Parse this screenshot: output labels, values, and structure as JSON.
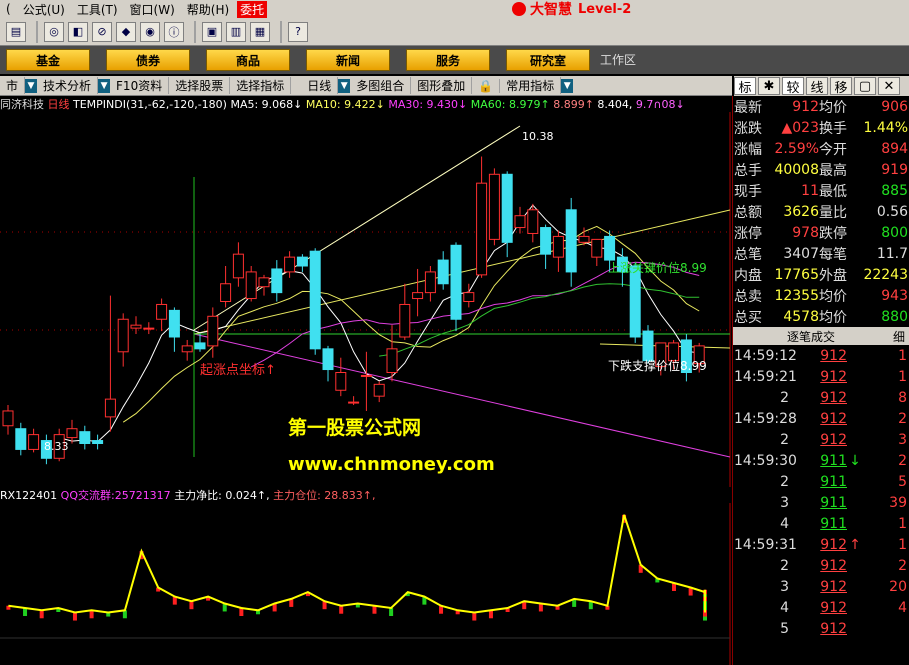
{
  "menu": {
    "items": [
      "公式(U)",
      "工具(T)",
      "窗口(W)",
      "帮助(H)"
    ],
    "lead": "(",
    "wt": "委托"
  },
  "brand": {
    "title": "大智慧",
    "level": "Level-2"
  },
  "nav": {
    "buttons": [
      "基金",
      "债券",
      "商品",
      "新闻",
      "服务",
      "研究室"
    ],
    "work": "工作区"
  },
  "tabs": {
    "items": [
      "市",
      "技术分析",
      "F10资料",
      "选择股票",
      "选择指标",
      "日线",
      "多图组合",
      "图形叠加",
      "常用指标"
    ]
  },
  "rtabs": [
    "标",
    "✱",
    "较",
    "线",
    "移",
    "▢",
    "✕"
  ],
  "info": {
    "stock": "同济科技",
    "period": "日线",
    "formula": "TEMPINDI(31,-62,-120,-180)",
    "ma5": "MA5: 9.068↓",
    "ma10": "MA10: 9.422↓",
    "ma30": "MA30: 9.430↓",
    "ma60": "MA60: 8.979↑",
    "v5": "8.899↑",
    "v6": "8.404,",
    "v7": "9.7∩08↓"
  },
  "ind2": {
    "name": "RX122401",
    "qq": "QQ交流群:25721317",
    "zl": "主力净比: 0.024↑,",
    "cw": "主力仓位: 28.833↑,"
  },
  "annot": {
    "high": "10.38",
    "low": "8.33",
    "up": "上涨关键价位8.99",
    "down": "下跌支撑价位8.99",
    "start": "起涨点坐标↑",
    "wm1": "第一股票公式网",
    "wm2": "www.chnmoney.com"
  },
  "quote": [
    {
      "l": "最新",
      "v": "912",
      "vc": "red",
      "l2": "均价",
      "v2": "906",
      "v2c": "red"
    },
    {
      "l": "涨跌",
      "v": "▲023",
      "vc": "red",
      "l2": "换手",
      "v2": "1.44%",
      "v2c": "yel"
    },
    {
      "l": "涨幅",
      "v": "2.59%",
      "vc": "red",
      "l2": "今开",
      "v2": "894",
      "v2c": "red"
    },
    {
      "l": "总手",
      "v": "40008",
      "vc": "yel",
      "l2": "最高",
      "v2": "919",
      "v2c": "red"
    },
    {
      "l": "现手",
      "v": "11",
      "vc": "red",
      "l2": "最低",
      "v2": "885",
      "v2c": "grn"
    },
    {
      "l": "总额",
      "v": "3626",
      "vc": "yel",
      "l2": "量比",
      "v2": "0.56",
      "v2c": "wht"
    },
    {
      "l": "涨停",
      "v": "978",
      "vc": "red",
      "l2": "跌停",
      "v2": "800",
      "v2c": "grn"
    },
    {
      "l": "总笔",
      "v": "3407",
      "vc": "wht",
      "l2": "每笔",
      "v2": "11.7",
      "v2c": "wht"
    },
    {
      "l": "内盘",
      "v": "17765",
      "vc": "yel",
      "l2": "外盘",
      "v2": "22243",
      "v2c": "yel"
    },
    {
      "l": "总卖",
      "v": "12355",
      "vc": "yel",
      "l2": "均价",
      "v2": "943",
      "v2c": "red"
    },
    {
      "l": "总买",
      "v": "4578",
      "vc": "yel",
      "l2": "均价",
      "v2": "880",
      "v2c": "grn"
    }
  ],
  "trades_head": {
    "title": "逐笔成交",
    "tab": "细"
  },
  "trades": [
    {
      "t": "14:59:12",
      "p": "912",
      "a": "",
      "av": "1",
      "c": "red"
    },
    {
      "t": "14:59:21",
      "p": "912",
      "a": "",
      "av": "1",
      "c": "red"
    },
    {
      "t": "2",
      "p": "912",
      "a": "",
      "av": "8",
      "c": "red"
    },
    {
      "t": "14:59:28",
      "p": "912",
      "a": "",
      "av": "2",
      "c": "red"
    },
    {
      "t": "2",
      "p": "912",
      "a": "",
      "av": "3",
      "c": "red"
    },
    {
      "t": "14:59:30",
      "p": "911",
      "a": "↓",
      "av": "2",
      "c": "grn"
    },
    {
      "t": "2",
      "p": "911",
      "a": "",
      "av": "5",
      "c": "grn"
    },
    {
      "t": "3",
      "p": "911",
      "a": "",
      "av": "39",
      "c": "grn"
    },
    {
      "t": "4",
      "p": "911",
      "a": "",
      "av": "1",
      "c": "grn"
    },
    {
      "t": "14:59:31",
      "p": "912",
      "a": "↑",
      "av": "1",
      "c": "red"
    },
    {
      "t": "2",
      "p": "912",
      "a": "",
      "av": "2",
      "c": "red"
    },
    {
      "t": "3",
      "p": "912",
      "a": "",
      "av": "20",
      "c": "red"
    },
    {
      "t": "4",
      "p": "912",
      "a": "",
      "av": "4",
      "c": "red"
    },
    {
      "t": "5",
      "p": "912",
      "a": "",
      "av": "",
      "c": "red"
    }
  ],
  "chart_data": {
    "type": "candlestick",
    "price_range": [
      8.2,
      10.6
    ],
    "candles": [
      [
        8.56,
        8.66,
        8.5,
        8.7
      ],
      [
        8.54,
        8.4,
        8.36,
        8.58
      ],
      [
        8.4,
        8.5,
        8.38,
        8.54
      ],
      [
        8.46,
        8.34,
        8.3,
        8.5
      ],
      [
        8.34,
        8.5,
        8.32,
        8.54
      ],
      [
        8.48,
        8.54,
        8.44,
        8.6
      ],
      [
        8.52,
        8.44,
        8.4,
        8.56
      ],
      [
        8.46,
        8.44,
        8.4,
        8.5
      ],
      [
        8.62,
        8.74,
        8.52,
        9.44
      ],
      [
        9.06,
        9.28,
        8.96,
        9.32
      ],
      [
        9.22,
        9.24,
        9.18,
        9.3
      ],
      [
        9.22,
        9.22,
        9.18,
        9.26
      ],
      [
        9.28,
        9.38,
        9.2,
        9.42
      ],
      [
        9.34,
        9.16,
        9.06,
        9.36
      ],
      [
        9.06,
        9.1,
        9.0,
        9.14
      ],
      [
        9.12,
        9.08,
        9.06,
        9.18
      ],
      [
        9.1,
        9.3,
        9.02,
        9.36
      ],
      [
        9.4,
        9.52,
        9.36,
        9.64
      ],
      [
        9.56,
        9.72,
        9.5,
        9.8
      ],
      [
        9.42,
        9.6,
        9.4,
        9.64
      ],
      [
        9.5,
        9.56,
        9.44,
        9.58
      ],
      [
        9.62,
        9.46,
        9.4,
        9.68
      ],
      [
        9.6,
        9.7,
        9.56,
        9.74
      ],
      [
        9.7,
        9.64,
        9.6,
        9.72
      ],
      [
        9.74,
        9.08,
        9.04,
        9.76
      ],
      [
        9.08,
        8.94,
        8.86,
        9.1
      ],
      [
        8.8,
        8.92,
        8.76,
        9.02
      ],
      [
        8.72,
        8.72,
        8.7,
        8.76
      ],
      [
        8.9,
        8.9,
        8.66,
        9.06
      ],
      [
        8.76,
        8.84,
        8.72,
        8.86
      ],
      [
        8.92,
        9.08,
        8.86,
        9.24
      ],
      [
        9.16,
        9.38,
        9.14,
        9.52
      ],
      [
        9.42,
        9.46,
        9.3,
        9.62
      ],
      [
        9.46,
        9.6,
        9.4,
        9.64
      ],
      [
        9.68,
        9.52,
        9.48,
        9.74
      ],
      [
        9.78,
        9.28,
        9.2,
        9.8
      ],
      [
        9.4,
        9.46,
        9.36,
        9.52
      ],
      [
        9.58,
        10.2,
        9.56,
        10.38
      ],
      [
        9.82,
        10.26,
        9.78,
        10.3
      ],
      [
        10.26,
        9.8,
        9.7,
        10.28
      ],
      [
        9.9,
        9.98,
        9.86,
        10.04
      ],
      [
        9.86,
        10.02,
        9.8,
        10.06
      ],
      [
        9.9,
        9.72,
        9.62,
        9.92
      ],
      [
        9.7,
        9.84,
        9.6,
        9.88
      ],
      [
        10.02,
        9.6,
        9.5,
        10.1
      ],
      [
        9.8,
        9.84,
        9.78,
        9.9
      ],
      [
        9.7,
        9.82,
        9.64,
        9.82
      ],
      [
        9.84,
        9.68,
        9.6,
        9.88
      ],
      [
        9.7,
        9.6,
        9.5,
        9.76
      ],
      [
        9.64,
        9.16,
        9.12,
        9.66
      ],
      [
        9.2,
        9.0,
        8.98,
        9.24
      ],
      [
        8.96,
        9.12,
        8.9,
        9.12
      ],
      [
        9.0,
        9.12,
        8.94,
        9.14
      ],
      [
        9.14,
        8.92,
        8.86,
        9.18
      ],
      [
        8.98,
        9.1,
        8.92,
        9.12
      ]
    ],
    "volume": [
      12,
      11,
      10,
      11,
      9,
      10,
      9,
      10,
      36,
      20,
      16,
      14,
      16,
      13,
      11,
      10,
      13,
      15,
      18,
      14,
      12,
      13,
      12,
      11,
      18,
      16,
      12,
      10,
      9,
      10,
      11,
      14,
      13,
      12,
      15,
      14,
      12,
      52,
      30,
      24,
      22,
      20,
      18,
      19,
      17,
      16,
      15,
      13,
      14,
      12,
      11,
      10,
      10,
      9,
      9
    ]
  }
}
